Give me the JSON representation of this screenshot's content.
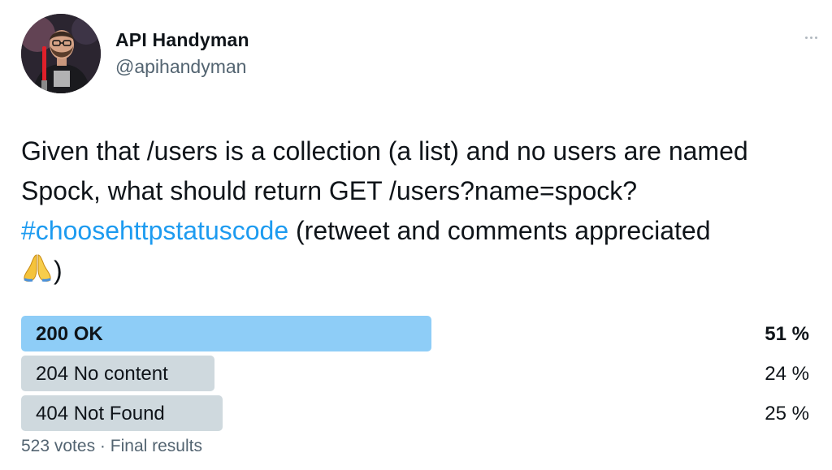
{
  "author": {
    "name": "API Handyman",
    "handle": "@apihandyman"
  },
  "tweet": {
    "text_part1": "Given that /users is a collection (a list) and no users are named Spock, what should return GET /users?name=spock? ",
    "hashtag": "#choosehttpstatuscode",
    "text_part2": " (retweet and comments appreciated ",
    "text_part3": ")",
    "emoji": "folded-hands-icon"
  },
  "poll": {
    "options": [
      {
        "label": "200 OK",
        "percent_label": "51 %",
        "percent": 51,
        "winner": true
      },
      {
        "label": "204 No content",
        "percent_label": "24 %",
        "percent": 24,
        "winner": false
      },
      {
        "label": "404 Not Found",
        "percent_label": "25 %",
        "percent": 25,
        "winner": false
      }
    ],
    "votes": "523 votes",
    "separator": "·",
    "status": "Final results"
  },
  "colors": {
    "winner_bar": "#8ecdf7",
    "other_bar": "#cfd9de",
    "hashtag": "#1d9bf0",
    "secondary_text": "#536471"
  }
}
